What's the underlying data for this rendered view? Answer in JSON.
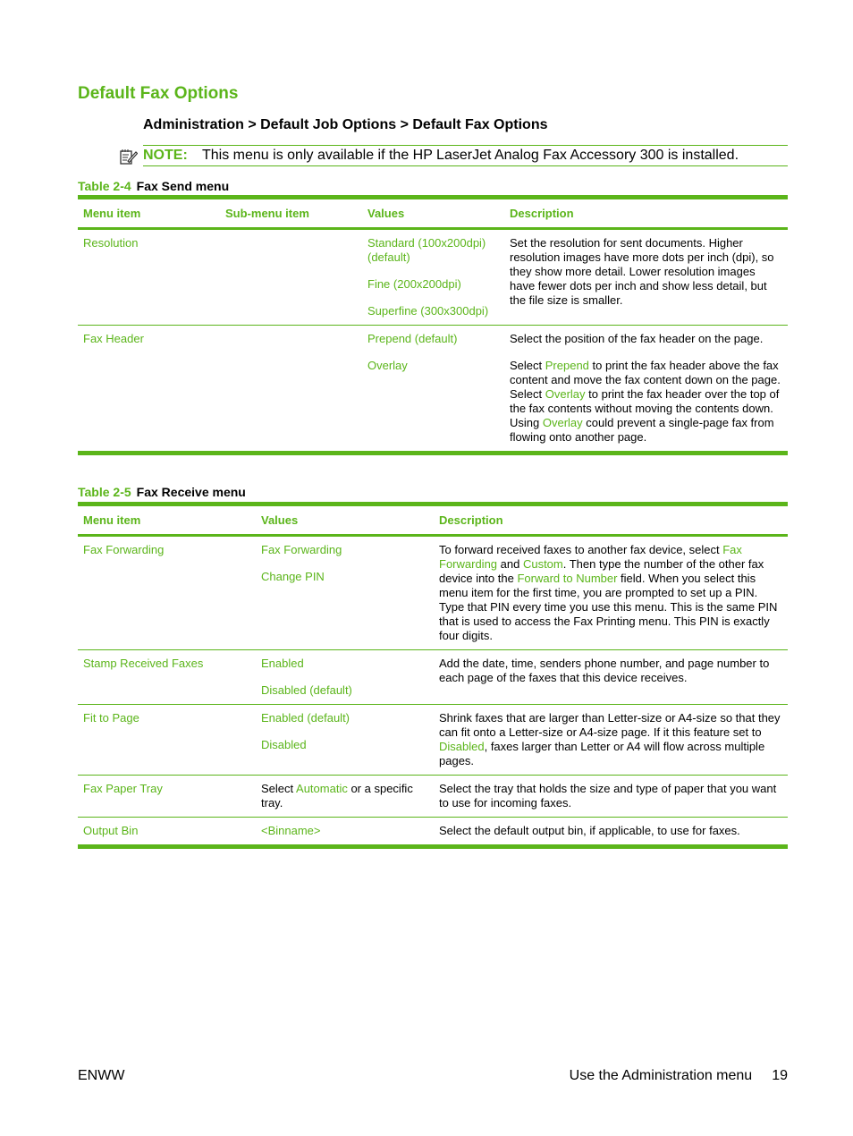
{
  "title": "Default Fax Options",
  "breadcrumb": "Administration > Default Job Options > Default Fax Options",
  "note": {
    "icon": "note-icon",
    "label": "NOTE:",
    "text": "This menu is only available if the HP LaserJet Analog Fax Accessory 300 is installed."
  },
  "colors": {
    "accent": "#5bb51a",
    "text": "#000000"
  },
  "table1": {
    "caption_num": "Table 2-4",
    "caption_title": "Fax Send menu",
    "headers": [
      "Menu item",
      "Sub-menu item",
      "Values",
      "Description"
    ],
    "rows": [
      {
        "menu_item": "Resolution",
        "sub_menu_item": "",
        "values": [
          "Standard (100x200dpi) (default)",
          "Fine (200x200dpi)",
          "Superfine (300x300dpi)"
        ],
        "description": [
          "Set the resolution for sent documents. Higher resolution images have more dots per inch (dpi), so they show more detail. Lower resolution images have fewer dots per inch and show less detail, but the file size is smaller."
        ]
      },
      {
        "menu_item": "Fax Header",
        "sub_menu_item": "",
        "values": [
          "Prepend (default)",
          "Overlay"
        ],
        "description": [
          "Select the position of the fax header on the page.",
          {
            "p1": "Select ",
            "g1": "Prepend",
            "p2": " to print the fax header above the fax content and move the fax content down on the page. Select ",
            "g2": "Overlay",
            "p3": " to print the fax header over the top of the fax contents without moving the contents down. Using ",
            "g3": "Overlay",
            "p4": " could prevent a single-page fax from flowing onto another page."
          }
        ]
      }
    ]
  },
  "table2": {
    "caption_num": "Table 2-5",
    "caption_title": "Fax Receive menu",
    "headers": [
      "Menu item",
      "Values",
      "Description"
    ],
    "rows": [
      {
        "menu_item": "Fax Forwarding",
        "values": [
          "Fax Forwarding",
          "Change PIN"
        ],
        "description": {
          "p1": "To forward received faxes to another fax device, select ",
          "g1": "Fax Forwarding",
          "p2": " and ",
          "g2": "Custom",
          "p3": ". Then type the number of the other fax device into the ",
          "g3": "Forward to Number",
          "p4": " field. When you select this menu item for the first time, you are prompted to set up a PIN. Type that PIN every time you use this menu. This is the same PIN that is used to access the Fax Printing menu. This PIN is exactly four digits."
        }
      },
      {
        "menu_item": "Stamp Received Faxes",
        "values": [
          "Enabled",
          "Disabled (default)"
        ],
        "description": {
          "p1": "Add the date, time, senders phone number, and page number to each page of the faxes that this device receives."
        }
      },
      {
        "menu_item": "Fit to Page",
        "values": [
          "Enabled (default)",
          "Disabled"
        ],
        "description": {
          "p1": "Shrink faxes that are larger than Letter-size or A4-size so that they can fit onto a Letter-size or A4-size page. If it this feature set to ",
          "g1": "Disabled",
          "p2": ", faxes larger than Letter or A4 will flow across multiple pages."
        }
      },
      {
        "menu_item": "Fax Paper Tray",
        "values_mixed": {
          "p1": "Select ",
          "g1": "Automatic",
          "p2": " or a specific tray."
        },
        "description": {
          "p1": "Select the tray that holds the size and type of paper that you want to use for incoming faxes."
        }
      },
      {
        "menu_item": "Output Bin",
        "values": [
          "<Binname>"
        ],
        "description": {
          "p1": "Select the default output bin, if applicable, to use for faxes."
        }
      }
    ]
  },
  "footer": {
    "left": "ENWW",
    "section": "Use the Administration menu",
    "page": "19"
  }
}
